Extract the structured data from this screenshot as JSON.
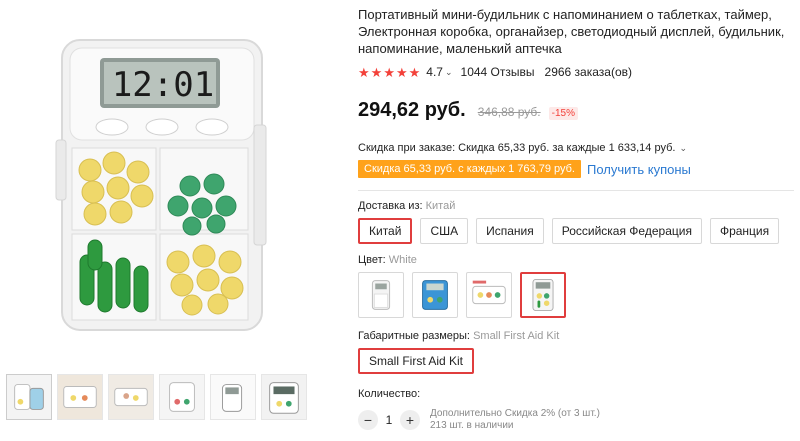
{
  "product": {
    "title": "Портативный мини-будильник с напоминанием о таблетках, таймер, Электронная коробка, органайзер, светодиодный дисплей, будильник, напоминание, маленький аптечка",
    "rating": "4.7",
    "reviews": "1044 Отзывы",
    "orders": "2966 заказа(ов)",
    "clock_display": "12:01"
  },
  "price": {
    "current": "294,62 руб.",
    "old": "346,88 руб.",
    "discount": "-15%"
  },
  "promo": {
    "line": "Скидка при заказе: Скидка 65,33 руб. за каждые 1 633,14 руб.",
    "coupon_tag": "Скидка 65,33 руб. с каждых 1 763,79 руб.",
    "coupon_link": "Получить купоны"
  },
  "shipping": {
    "label": "Доставка из:",
    "selected": "Китай",
    "options": [
      "Китай",
      "США",
      "Испания",
      "Российская Федерация",
      "Франция"
    ]
  },
  "color": {
    "label": "Цвет:",
    "selected": "White"
  },
  "size": {
    "label": "Габаритные размеры:",
    "selected": "Small First Aid Kit",
    "option": "Small First Aid Kit"
  },
  "quantity": {
    "label": "Количество:",
    "value": "1",
    "minus": "−",
    "plus": "+",
    "note_line1": "Дополнительно Скидка 2% (от 3 шт.)",
    "note_line2": "213 шт. в наличии"
  },
  "colors": {
    "accent": "#e03d3d",
    "star": "#f3413a",
    "coupon": "#ffa21a",
    "link": "#2a79d1"
  },
  "icons": {
    "star": "star-icon",
    "chevron": "chevron-down-icon"
  }
}
